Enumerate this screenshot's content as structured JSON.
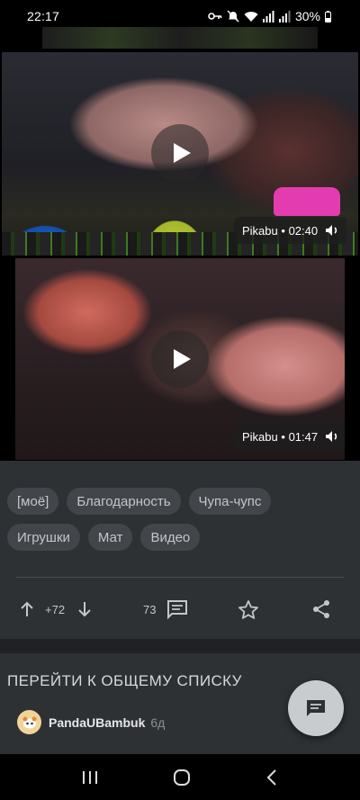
{
  "status_bar": {
    "time": "22:17",
    "battery": "30%",
    "icons": [
      "key-icon",
      "mute-icon",
      "wifi-icon",
      "signal-icon",
      "signal-icon",
      "battery-icon"
    ]
  },
  "videos": [
    {
      "source": "Pikabu",
      "duration": "02:40"
    },
    {
      "source": "Pikabu",
      "duration": "01:47"
    }
  ],
  "tags": [
    "[моё]",
    "Благодарность",
    "Чупа-чупс",
    "Игрушки",
    "Мат",
    "Видео"
  ],
  "actions": {
    "rating": "+72",
    "comments": "73"
  },
  "list": {
    "title": "ПЕРЕЙТИ К ОБЩЕМУ СПИСКУ"
  },
  "comment": {
    "author": "PandaUBambuk",
    "time": "6д"
  },
  "colors": {
    "background": "#2e3134",
    "tag_background": "#42464a",
    "fab": "#c9cccf"
  }
}
